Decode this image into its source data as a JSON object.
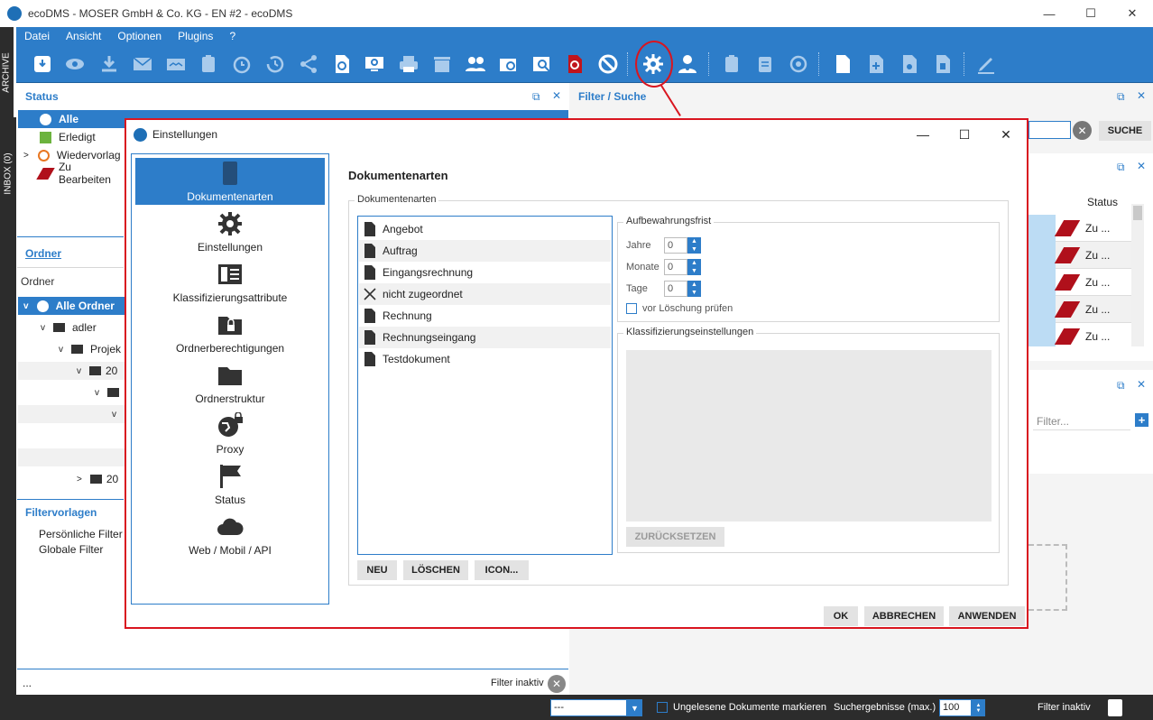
{
  "window": {
    "title": "ecoDMS - MOSER GmbH & Co. KG - EN #2 - ecoDMS",
    "minimize": "—",
    "maximize": "☐",
    "close": "✕"
  },
  "side_tabs": {
    "archive": "ARCHIVE",
    "inbox": "INBOX (0)"
  },
  "menu": [
    "Datei",
    "Ansicht",
    "Optionen",
    "Plugins",
    "?"
  ],
  "toolbar_icons": [
    "scan-icon",
    "eye-icon",
    "download-icon",
    "mail-icon",
    "mail-open-icon",
    "clipboard-link-icon",
    "alarm-icon",
    "history-icon",
    "share-icon",
    "refresh-doc-icon",
    "monitor-refresh-icon",
    "print-icon",
    "trash-box-icon",
    "users-icon",
    "search-folder-icon",
    "search-doc-icon",
    "tag-icon",
    "block-icon",
    "gear-icon",
    "user-gear-icon",
    "clipboard-icon",
    "clipboard-list-icon",
    "target-icon",
    "doc-icon",
    "doc-add-icon",
    "doc-edit-icon",
    "doc-split-icon",
    "pencil-icon"
  ],
  "status_panel": {
    "title": "Status",
    "rows": [
      "Alle",
      "Erledigt",
      "Wiedervorlag",
      "Zu Bearbeiten"
    ]
  },
  "ordner_panel": {
    "title": "Ordner",
    "header": "Ordner",
    "rows": [
      "Alle Ordner",
      "adler",
      "Projek",
      "20",
      "20"
    ]
  },
  "filtervorlagen_panel": {
    "title": "Filtervorlagen",
    "rows": [
      "Persönliche Filter",
      "Globale Filter"
    ]
  },
  "filter_suche": {
    "title": "Filter / Suche",
    "search_button": "SUCHE"
  },
  "results": {
    "status_header": "Status",
    "status_values": [
      "Zu ...",
      "Zu ...",
      "Zu ...",
      "Zu ...",
      "Zu ..."
    ]
  },
  "right_filter": {
    "placeholder": "Filter..."
  },
  "left_footer": {
    "dots": "...",
    "filter_status": "Filter inaktiv"
  },
  "bottom_bar": {
    "dropdown_value": "---",
    "unread_label": "Ungelesene Dokumente markieren",
    "results_label": "Suchergebnisse (max.)",
    "results_value": "100",
    "filter_status": "Filter inaktiv"
  },
  "dialog": {
    "title": "Einstellungen",
    "nav": [
      {
        "label": "Dokumentenarten",
        "icon": "bookmark-icon",
        "selected": true
      },
      {
        "label": "Einstellungen",
        "icon": "gear-icon"
      },
      {
        "label": "Klassifizierungsattribute",
        "icon": "form-icon"
      },
      {
        "label": "Ordnerberechtigungen",
        "icon": "folder-lock-icon"
      },
      {
        "label": "Ordnerstruktur",
        "icon": "folder-icon"
      },
      {
        "label": "Proxy",
        "icon": "globe-lock-icon"
      },
      {
        "label": "Status",
        "icon": "flag-icon"
      },
      {
        "label": "Web / Mobil / API",
        "icon": "cloud-icon"
      }
    ],
    "content_title": "Dokumentenarten",
    "group_title": "Dokumentenarten",
    "doc_types": [
      {
        "name": "Angebot",
        "icon": "doc-icon"
      },
      {
        "name": "Auftrag",
        "icon": "doc-icon"
      },
      {
        "name": "Eingangsrechnung",
        "icon": "doc-icon"
      },
      {
        "name": "nicht zugeordnet",
        "icon": "x-icon"
      },
      {
        "name": "Rechnung",
        "icon": "doc-icon"
      },
      {
        "name": "Rechnungseingang",
        "icon": "doc-icon"
      },
      {
        "name": "Testdokument",
        "icon": "doc-icon"
      }
    ],
    "list_buttons": {
      "new": "NEU",
      "delete": "LÖSCHEN",
      "icon": "ICON..."
    },
    "retention": {
      "title": "Aufbewahrungsfrist",
      "years_label": "Jahre",
      "years_value": "0",
      "months_label": "Monate",
      "months_value": "0",
      "days_label": "Tage",
      "days_value": "0",
      "check_label": "vor Löschung prüfen"
    },
    "classification": {
      "title": "Klassifizierungseinstellungen",
      "reset": "ZURÜCKSETZEN"
    },
    "footer_buttons": {
      "ok": "OK",
      "cancel": "ABBRECHEN",
      "apply": "ANWENDEN"
    }
  }
}
